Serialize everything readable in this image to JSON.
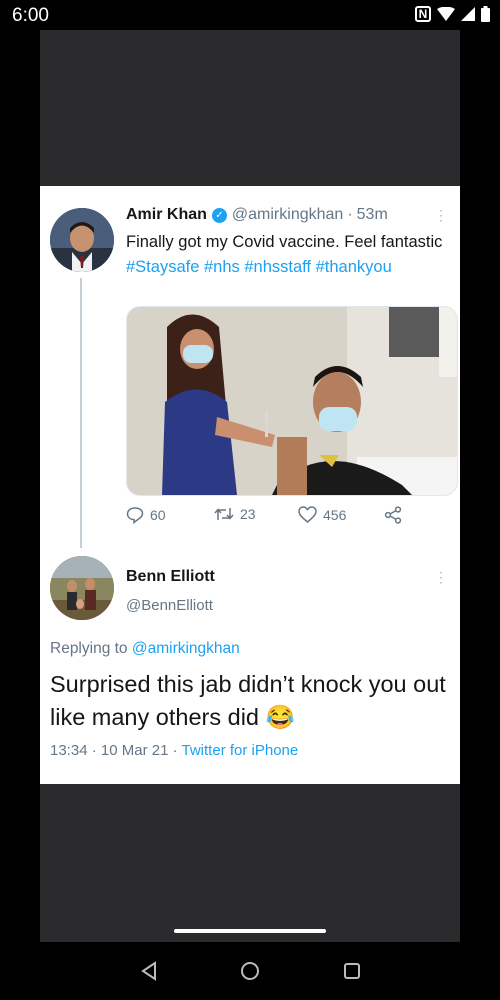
{
  "status_bar": {
    "time": "6:00",
    "nfc": "N"
  },
  "tweet": {
    "author_name": "Amir Khan",
    "handle": "@amirkingkhan",
    "separator": "·",
    "age": "53m",
    "text_plain": "Finally got my Covid vaccine. Feel fantastic",
    "hashtags": [
      "#Staysafe",
      "#nhs",
      "#nhsstaff",
      "#thankyou"
    ],
    "counts": {
      "replies": "60",
      "retweets": "23",
      "likes": "456"
    }
  },
  "reply": {
    "author_name": "Benn Elliott",
    "handle": "@BennElliott",
    "replying_prefix": "Replying to",
    "replying_handle": "@amirkingkhan",
    "text": "Surprised this jab didn’t knock you out like many others did",
    "emoji": "😂",
    "time": "13:34",
    "separator": "·",
    "date": "10 Mar 21",
    "source_separator": "·",
    "source": "Twitter for iPhone"
  },
  "icons": [
    "signal-icon",
    "wifi-icon",
    "battery-icon",
    "verified-icon",
    "more-icon",
    "reply-icon",
    "retweet-icon",
    "like-icon",
    "share-icon",
    "back-icon",
    "home-icon",
    "recents-icon"
  ],
  "colors": {
    "link": "#1da1f2",
    "muted": "#657786",
    "card": "#ffffff",
    "viewer": "#2b2b2d"
  }
}
